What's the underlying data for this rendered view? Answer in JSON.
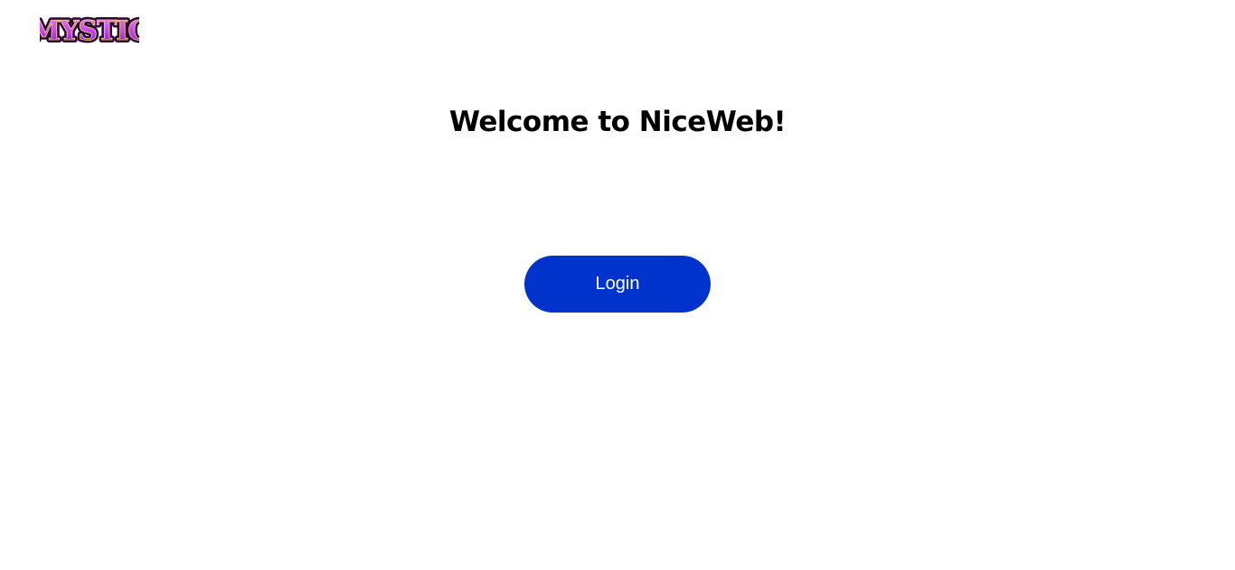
{
  "header": {
    "logo_text": "MYSTIC",
    "logo_colors": {
      "fill_top": "#e35bff",
      "fill_bottom": "#7a1fb8",
      "outline": "#2a0a3d",
      "highlight": "#ffd76a"
    }
  },
  "main": {
    "title": "Welcome to NiceWeb!",
    "login_label": "Login"
  },
  "colors": {
    "background": "#ffffff",
    "title_text": "#000000",
    "button_bg": "#0033cc",
    "button_text": "#ffffff"
  }
}
